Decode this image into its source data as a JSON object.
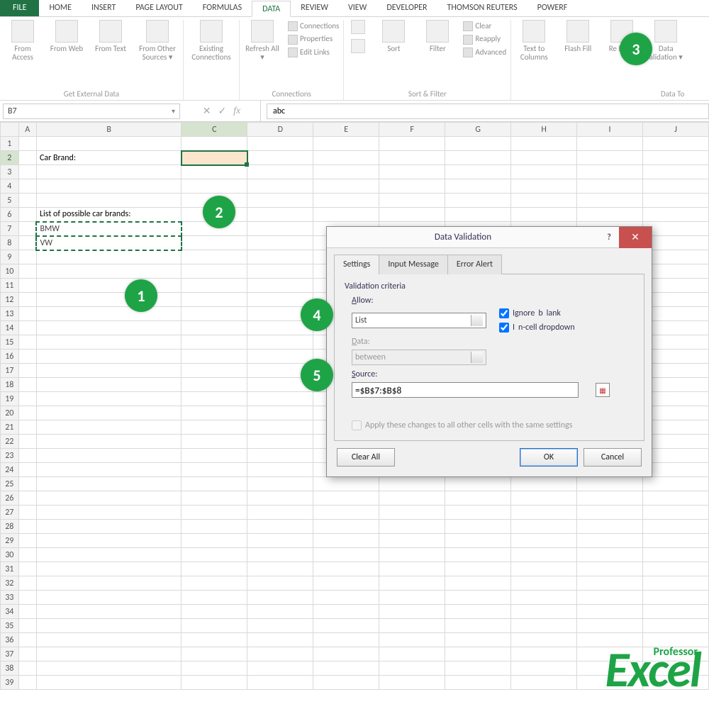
{
  "tabs": {
    "file": "FILE",
    "items": [
      "HOME",
      "INSERT",
      "PAGE LAYOUT",
      "FORMULAS",
      "DATA",
      "REVIEW",
      "VIEW",
      "DEVELOPER",
      "THOMSON REUTERS",
      "POWERF"
    ],
    "active": "DATA"
  },
  "ribbon": {
    "g1": {
      "label": "Get External Data",
      "i": [
        "From Access",
        "From Web",
        "From Text",
        "From Other Sources ▾"
      ]
    },
    "g2": {
      "label": "",
      "i": [
        "Existing Connections"
      ]
    },
    "g3": {
      "label": "Connections",
      "i1": "Refresh All ▾",
      "mini": [
        "Connections",
        "Properties",
        "Edit Links"
      ]
    },
    "g4": {
      "label": "Sort & Filter",
      "sort": "Sort",
      "filter": "Filter",
      "mini": [
        "Clear",
        "Reapply",
        "Advanced"
      ]
    },
    "g5": {
      "label": "Data To",
      "i": [
        "Text to Columns",
        "Flash Fill",
        "Re\nDupli",
        "Data alidation ▾"
      ]
    }
  },
  "formula_bar": {
    "name_box": "B7",
    "value": "abc"
  },
  "columns": [
    "",
    "A",
    "B",
    "C",
    "D",
    "E",
    "F",
    "G",
    "H",
    "I",
    "J"
  ],
  "cells": {
    "B2": "Car Brand:",
    "B6": "List of possible car brands:",
    "B7": "BMW",
    "B8": "VW"
  },
  "dialog": {
    "title": "Data Validation",
    "tabs": [
      "Settings",
      "Input Message",
      "Error Alert"
    ],
    "section": "Validation criteria",
    "allow_label": "Allow:",
    "allow_value": "List",
    "ignore_blank": "Ignore blank",
    "incell_dd": "In-cell dropdown",
    "data_label": "Data:",
    "data_value": "between",
    "source_label": "Source:",
    "source_value": "=$B$7:$B$8",
    "apply_all": "Apply these changes to all other cells with the same settings",
    "clear": "Clear All",
    "ok": "OK",
    "cancel": "Cancel"
  },
  "badges": {
    "b1": "1",
    "b2": "2",
    "b3": "3",
    "b4": "4",
    "b5": "5"
  },
  "watermark": {
    "small": "Professor",
    "big": "Excel"
  }
}
